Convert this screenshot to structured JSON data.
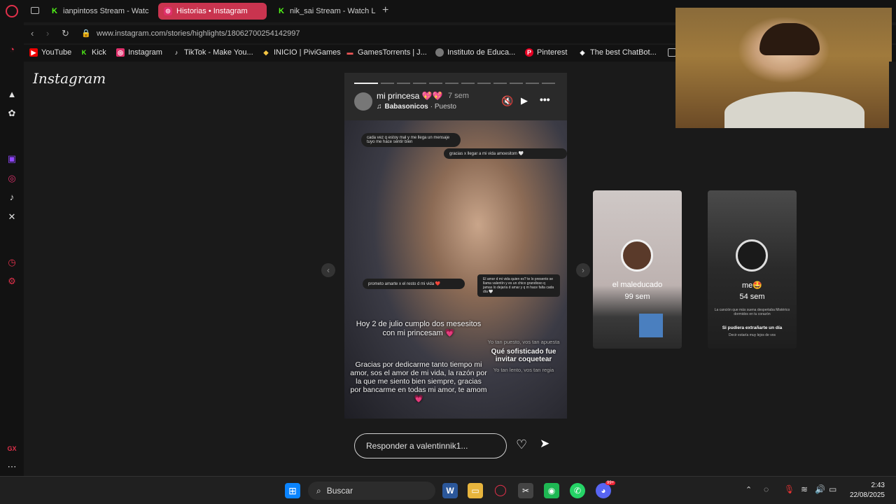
{
  "tabs": [
    {
      "label": "ianpintoss Stream - Watc",
      "icon": "kick-icon"
    },
    {
      "label": "Historias • Instagram",
      "icon": "instagram-icon",
      "active": true
    },
    {
      "label": "nik_sai Stream - Watch L",
      "icon": "kick-icon"
    }
  ],
  "address": {
    "url": "www.instagram.com/stories/highlights/18062700254142997"
  },
  "bookmarks": [
    "YouTube",
    "Kick",
    "Instagram",
    "TikTok - Make You...",
    "INICIO | PiviGames",
    "GamesTorrents | J...",
    "Instituto de Educa...",
    "Pinterest",
    "The best ChatBot..."
  ],
  "instagram": {
    "logo": "Instagram"
  },
  "story": {
    "username": "mi princesa 💖💖",
    "time": "7 sem",
    "song": "Babasonicos",
    "song_suffix": "· Puesto",
    "bubble_1": "cada vez q estoy mal y me llega un mensaje tuyo me hace sentir bien",
    "bubble_2": "gracias x llegar a mi vida amoesitom 🤍",
    "bubble_3": "prometo amarte x el resto d mi vida ❤️",
    "bubble_4": "El amor d mi vida quien es? te lo presento se llama valentín y es un chico grandioso q jamas lo dejaría d amar y q m hace falta cada día 🤍",
    "caption_1": "Hoy 2 de julio cumplo dos mesesitos con mi princesam 💗",
    "caption_2": "Gracias por dedicarme tanto tiempo mi amor, sos el amor de mi vida, la razón por la que me siento bien siempre, gracias por bancarme en todas mi amor, te amom 💗",
    "lyric_1": "Yo tan puesto, vos tan apuesta",
    "lyric_2": "Qué sofisticado fue invitar coquetear",
    "lyric_3": "Yo tan lento, vos tan regia"
  },
  "next_stories": [
    {
      "name": "el maleducado",
      "time": "99 sem"
    },
    {
      "name": "me🤩",
      "time": "54 sem",
      "text_1": "La canción que más suena despertaba Mistérico dormidos en tu corazón",
      "text_2": "Si pudiera extrañarte un día",
      "text_3": "Decir estaría muy lejos de vos"
    }
  ],
  "reply": {
    "placeholder": "Responder a valentinnik1..."
  },
  "taskbar": {
    "search": "Buscar",
    "time": "2:43",
    "date": "22/08/2025",
    "discord_badge": "99+"
  },
  "sidebar": {
    "gx_label": "GX"
  }
}
